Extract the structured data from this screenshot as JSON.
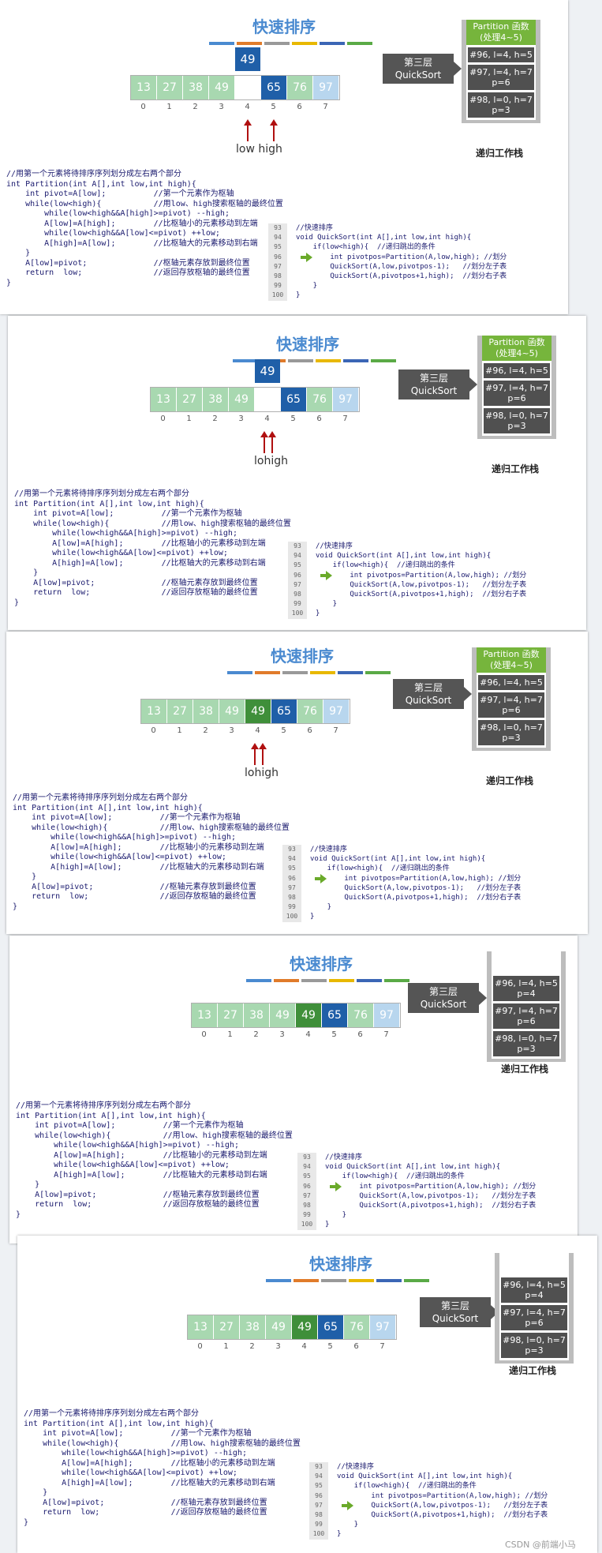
{
  "title": "快速排序",
  "layer_tag": [
    "第三层",
    "QuickSort"
  ],
  "stack_header": "Partition 函数\n(处理4~5)",
  "stack_caption": "递归工作栈",
  "indices": [
    "0",
    "1",
    "2",
    "3",
    "4",
    "5",
    "6",
    "7"
  ],
  "labels": {
    "low": "low",
    "high": "high"
  },
  "partition_code": [
    "//用第一个元素将待排序序列划分成左右两个部分",
    "int Partition(int A[],int low,int high){",
    "    int pivot=A[low];          //第一个元素作为枢轴",
    "    while(low<high){           //用low、high搜索枢轴的最终位置",
    "        while(low<high&&A[high]>=pivot) --high;",
    "        A[low]=A[high];        //比枢轴小的元素移动到左端",
    "        while(low<high&&A[low]<=pivot) ++low;",
    "        A[high]=A[low];        //比枢轴大的元素移动到右端",
    "    }",
    "    A[low]=pivot;              //枢轴元素存放到最终位置",
    "    return  low;               //返回存放枢轴的最终位置",
    "}"
  ],
  "quicksort_code": [
    "//快速排序",
    "void QuickSort(int A[],int low,int high){",
    "    if(low<high){  //递归跳出的条件",
    "        int pivotpos=Partition(A,low,high); //划分",
    "        QuickSort(A,low,pivotpos-1);   //划分左子表",
    "        QuickSort(A,pivotpos+1,high);  //划分右子表",
    "    }",
    "}"
  ],
  "line_numbers": [
    "93",
    "94",
    "95",
    "96",
    "97",
    "98",
    "99",
    "100"
  ],
  "colors": {
    "title": "#4a8ad0",
    "bar": [
      "#4a8ad0",
      "#e07b2a",
      "#999999",
      "#e8b800",
      "#3b66b5",
      "#5aaa46"
    ]
  },
  "slides": [
    {
      "pivot": "49",
      "cells": [
        {
          "v": "13",
          "c": "green"
        },
        {
          "v": "27",
          "c": "green"
        },
        {
          "v": "38",
          "c": "green"
        },
        {
          "v": "49",
          "c": "green"
        },
        {
          "v": "",
          "c": "empty"
        },
        {
          "v": "65",
          "c": "blue"
        },
        {
          "v": "76",
          "c": "green"
        },
        {
          "v": "97",
          "c": "lightblue"
        }
      ],
      "frames": [
        "#96, l=4, h=5",
        "#97, l=4, h=7\np=6",
        "#98, l=0, h=7\np=3"
      ],
      "pointer_label": "low high",
      "exec_line": 3
    },
    {
      "pivot": "49",
      "cells": [
        {
          "v": "13",
          "c": "green"
        },
        {
          "v": "27",
          "c": "green"
        },
        {
          "v": "38",
          "c": "green"
        },
        {
          "v": "49",
          "c": "green"
        },
        {
          "v": "",
          "c": "empty"
        },
        {
          "v": "65",
          "c": "blue"
        },
        {
          "v": "76",
          "c": "green"
        },
        {
          "v": "97",
          "c": "lightblue"
        }
      ],
      "frames": [
        "#96, l=4, h=5",
        "#97, l=4, h=7\np=6",
        "#98, l=0, h=7\np=3"
      ],
      "pointer_label": "lowhigh",
      "exec_line": 3
    },
    {
      "pivot": "",
      "cells": [
        {
          "v": "13",
          "c": "green"
        },
        {
          "v": "27",
          "c": "green"
        },
        {
          "v": "38",
          "c": "green"
        },
        {
          "v": "49",
          "c": "green"
        },
        {
          "v": "49",
          "c": "darkgreen"
        },
        {
          "v": "65",
          "c": "blue"
        },
        {
          "v": "76",
          "c": "green"
        },
        {
          "v": "97",
          "c": "lightblue"
        }
      ],
      "frames": [
        "#96, l=4, h=5",
        "#97, l=4, h=7\np=6",
        "#98, l=0, h=7\np=3"
      ],
      "pointer_label": "lowhigh",
      "exec_line": 3
    },
    {
      "pivot": "",
      "cells": [
        {
          "v": "13",
          "c": "green"
        },
        {
          "v": "27",
          "c": "green"
        },
        {
          "v": "38",
          "c": "green"
        },
        {
          "v": "49",
          "c": "green"
        },
        {
          "v": "49",
          "c": "darkgreen"
        },
        {
          "v": "65",
          "c": "blue"
        },
        {
          "v": "76",
          "c": "green"
        },
        {
          "v": "97",
          "c": "lightblue"
        }
      ],
      "frames": [
        "#96, l=4, h=5\np=4",
        "#97, l=4, h=7\np=6",
        "#98, l=0, h=7\np=3"
      ],
      "pointer_label": "",
      "exec_line": 3
    },
    {
      "pivot": "",
      "cells": [
        {
          "v": "13",
          "c": "green"
        },
        {
          "v": "27",
          "c": "green"
        },
        {
          "v": "38",
          "c": "green"
        },
        {
          "v": "49",
          "c": "green"
        },
        {
          "v": "49",
          "c": "darkgreen"
        },
        {
          "v": "65",
          "c": "blue"
        },
        {
          "v": "76",
          "c": "green"
        },
        {
          "v": "97",
          "c": "lightblue"
        }
      ],
      "frames": [
        "#96, l=4, h=5\np=4",
        "#97, l=4, h=7\np=6",
        "#98, l=0, h=7\np=3"
      ],
      "pointer_label": "",
      "exec_line": 4
    }
  ],
  "watermark": "CSDN @前端小马"
}
